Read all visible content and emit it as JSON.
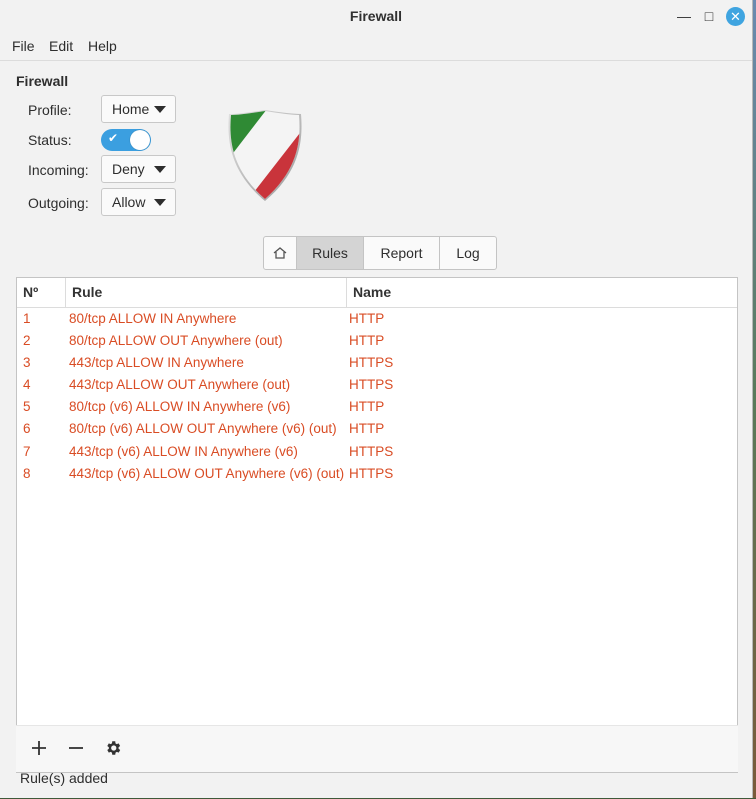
{
  "window": {
    "title": "Firewall"
  },
  "menu": {
    "file": "File",
    "edit": "Edit",
    "help": "Help"
  },
  "firewall": {
    "section_title": "Firewall",
    "profile_label": "Profile:",
    "profile_value": "Home",
    "status_label": "Status:",
    "status_on": true,
    "incoming_label": "Incoming:",
    "incoming_value": "Deny",
    "outgoing_label": "Outgoing:",
    "outgoing_value": "Allow"
  },
  "tabs": {
    "rules": "Rules",
    "report": "Report",
    "log": "Log",
    "active": "Rules"
  },
  "table": {
    "headers": {
      "no": "Nº",
      "rule": "Rule",
      "name": "Name"
    },
    "rows": [
      {
        "no": "1",
        "rule": "80/tcp ALLOW IN Anywhere",
        "name": "HTTP"
      },
      {
        "no": "2",
        "rule": "80/tcp ALLOW OUT Anywhere (out)",
        "name": "HTTP"
      },
      {
        "no": "3",
        "rule": "443/tcp ALLOW IN Anywhere",
        "name": "HTTPS"
      },
      {
        "no": "4",
        "rule": "443/tcp ALLOW OUT Anywhere (out)",
        "name": "HTTPS"
      },
      {
        "no": "5",
        "rule": "80/tcp (v6) ALLOW IN Anywhere (v6)",
        "name": "HTTP"
      },
      {
        "no": "6",
        "rule": "80/tcp (v6) ALLOW OUT Anywhere (v6) (out)",
        "name": "HTTP"
      },
      {
        "no": "7",
        "rule": "443/tcp (v6) ALLOW IN Anywhere (v6)",
        "name": "HTTPS"
      },
      {
        "no": "8",
        "rule": "443/tcp (v6) ALLOW OUT Anywhere (v6) (out)",
        "name": "HTTPS"
      }
    ],
    "row_color": "#d94c24"
  },
  "toolbar": {
    "add_icon": "plus-icon",
    "remove_icon": "minus-icon",
    "settings_icon": "gear-icon"
  },
  "status": {
    "message": "Rule(s) added"
  },
  "colors": {
    "accent": "#3b9fe0",
    "rule_text": "#d94c24"
  }
}
